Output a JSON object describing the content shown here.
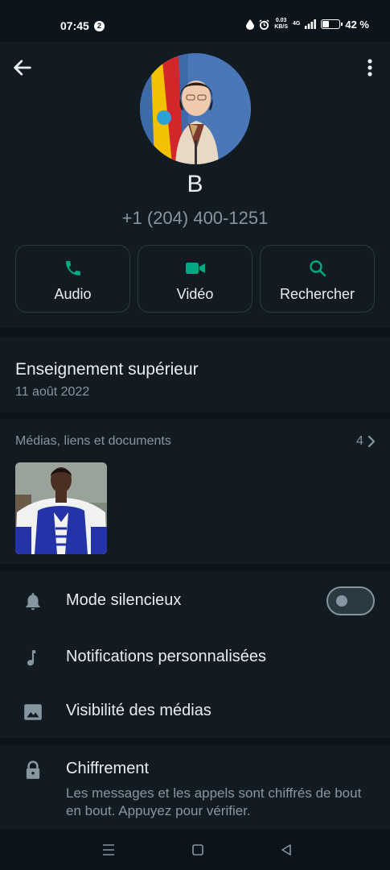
{
  "status_bar": {
    "time": "07:45",
    "notification_count": "2",
    "speed_value": "0.03",
    "speed_unit": "KB/S",
    "network": "4G",
    "battery_percent": "42 %",
    "battery_level": 0.42
  },
  "header": {
    "back_icon": "arrow-left-icon",
    "more_icon": "more-vertical-icon"
  },
  "contact": {
    "name": "B",
    "phone": "+1 (204) 400-1251"
  },
  "actions": [
    {
      "label": "Audio",
      "icon": "phone-icon"
    },
    {
      "label": "Vidéo",
      "icon": "video-icon"
    },
    {
      "label": "Rechercher",
      "icon": "search-icon"
    }
  ],
  "about": {
    "text": "Enseignement supérieur",
    "date": "11 août 2022"
  },
  "media": {
    "label": "Médias, liens et documents",
    "count": "4"
  },
  "settings": [
    {
      "label": "Mode silencieux",
      "icon": "bell-icon",
      "toggle": false
    },
    {
      "label": "Notifications personnalisées",
      "icon": "music-note-icon"
    },
    {
      "label": "Visibilité des médias",
      "icon": "image-icon"
    }
  ],
  "encryption": {
    "title": "Chiffrement",
    "description": "Les messages et les appels sont chiffrés de bout en bout. Appuyez pour vérifier.",
    "icon": "lock-icon"
  },
  "colors": {
    "accent": "#00a884",
    "background": "#0b141a",
    "surface": "#111b21",
    "secondary_text": "#8696a0"
  },
  "nav_bar": {
    "icons": [
      "menu-icon",
      "home-square-icon",
      "back-triangle-icon"
    ]
  }
}
